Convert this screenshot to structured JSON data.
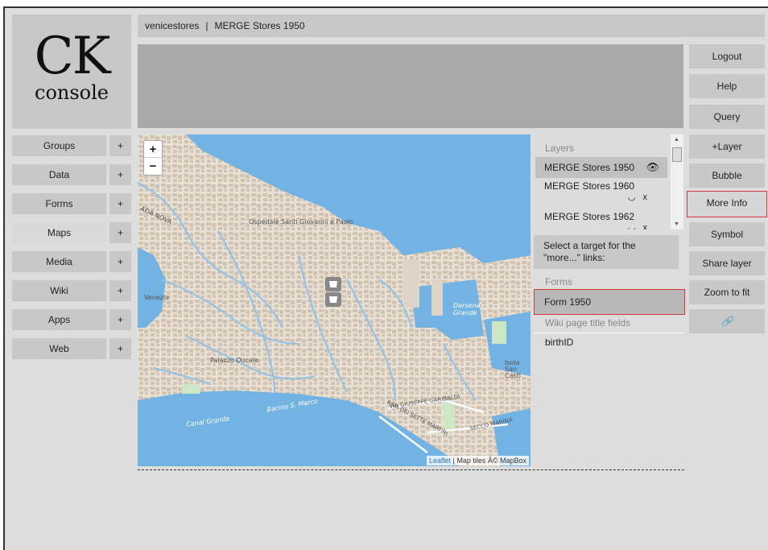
{
  "logo": {
    "big": "CK",
    "small": "console"
  },
  "breadcrumb": {
    "group": "venicestores",
    "separator": "|",
    "page": "MERGE Stores 1950"
  },
  "right_menu": [
    "Logout",
    "Help",
    "Query",
    "+Layer",
    "Bubble",
    "More Info",
    "Symbol",
    "Share layer",
    "Zoom to fit",
    "🔗"
  ],
  "nav": [
    {
      "label": "Groups",
      "plus": "+"
    },
    {
      "label": "Data",
      "plus": "+"
    },
    {
      "label": "Forms",
      "plus": "+"
    },
    {
      "label": "Maps",
      "plus": "+"
    },
    {
      "label": "Media",
      "plus": "+"
    },
    {
      "label": "Wiki",
      "plus": "+"
    },
    {
      "label": "Apps",
      "plus": "+"
    },
    {
      "label": "Web",
      "plus": "+"
    }
  ],
  "map": {
    "zoom_in": "+",
    "zoom_out": "−",
    "attribution_link": "Leaflet",
    "attribution_rest": " | Map tiles Â© MapBox",
    "labels": {
      "ospedale": "Ospedale Santi Giovanni e Paolo",
      "venezia": "Venezia",
      "palazzo": "Palazzo Ducale",
      "nova": "ADA NOVA",
      "darsena": "Darsena Grande",
      "bacino": "Bacino S. Marco",
      "canal": "Canal Grande",
      "garibaldi": "VIA GIUSEPPE GARIBALDI",
      "settemartiri": "RIVA DEI SETTE MARTIRI",
      "seccomarina": "SECCO MARINA",
      "isola": "Isola San Casti"
    }
  },
  "panel": {
    "layers_title": "Layers",
    "layers": [
      {
        "name": "MERGE Stores 1950",
        "icon": "👁"
      },
      {
        "name": "MERGE Stores 1960",
        "icon": "◡",
        "close": "x"
      },
      {
        "name": "MERGE Stores 1962",
        "icon": "◡",
        "close": "x"
      }
    ],
    "select_target": "Select a target for the \"more...\" links:",
    "forms_title": "Forms",
    "form_item": "Form 1950",
    "wiki_title": "Wiki page title fields",
    "wiki_field": "birthID"
  },
  "colors": {
    "water": "#72b3e4",
    "land": "#e9e1d6",
    "buildings": "#d2c4b2",
    "canal": "#8ec2ea",
    "highlight": "#d43a3a"
  }
}
